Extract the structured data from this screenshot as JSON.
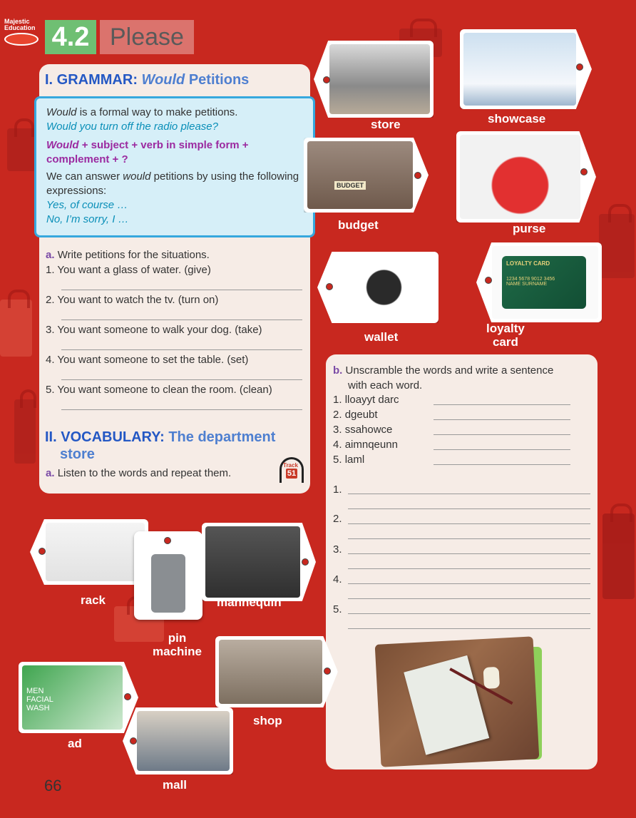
{
  "logo": {
    "line1": "Majestic",
    "line2": "Education"
  },
  "unit": {
    "number": "4.2",
    "title": "Please"
  },
  "grammar": {
    "heading_prefix": "I. GRAMMAR:",
    "heading_italic": "Would",
    "heading_rest": "Petitions",
    "box": {
      "p1_italic": "Would",
      "p1_rest": "is a formal way to make petitions.",
      "p2": "Would you turn off the radio please?",
      "p3_italic": "Would",
      "p3_rest": "+ subject + verb in simple form + complement + ?",
      "p4_a": "We can answer",
      "p4_italic": "would",
      "p4_b": "petitions by using the following expressions:",
      "p5": "Yes, of course …",
      "p6": "No, I’m sorry, I …"
    },
    "exercise_a": {
      "label": "a.",
      "instruction": "Write petitions for the situations.",
      "items": [
        {
          "num": "1.",
          "text": "You want a glass of water. (give)"
        },
        {
          "num": "2.",
          "text": "You want to watch the tv. (turn on)"
        },
        {
          "num": "3.",
          "text": "You want someone to walk your dog. (take)"
        },
        {
          "num": "4.",
          "text": "You want someone to set the table. (set)"
        },
        {
          "num": "5.",
          "text": "You want someone to clean the room. (clean)"
        }
      ]
    }
  },
  "vocabulary": {
    "heading_prefix": "II. VOCABULARY:",
    "heading_rest_1": "The department",
    "heading_rest_2": "store",
    "exercise_a": {
      "label": "a.",
      "instruction": "Listen to the words and repeat them."
    },
    "track": {
      "label": "Track",
      "number": "51"
    }
  },
  "unscramble": {
    "label": "b.",
    "instruction_1": "Unscramble the words and write a sentence",
    "instruction_2": "with each word.",
    "words": [
      {
        "num": "1.",
        "text": "lloayyt darc"
      },
      {
        "num": "2.",
        "text": "dgeubt"
      },
      {
        "num": "3.",
        "text": "ssahowce"
      },
      {
        "num": "4.",
        "text": "aimnqeunn"
      },
      {
        "num": "5.",
        "text": "laml"
      }
    ],
    "sentence_numbers": [
      "1.",
      "2.",
      "3.",
      "4.",
      "5."
    ]
  },
  "tags": {
    "store": "store",
    "showcase": "showcase",
    "budget": "budget",
    "purse": "purse",
    "wallet": "wallet",
    "loyalty_1": "loyalty",
    "loyalty_2": "card",
    "rack": "rack",
    "mannequin": "mannequin",
    "pin_1": "pin",
    "pin_2": "machine",
    "shop": "shop",
    "ad": "ad",
    "mall": "mall"
  },
  "photo_text": {
    "budget_jar": "BUDGET",
    "loyalty_title": "LOYALTY CARD",
    "loyalty_number": "1234 5678 9012 3456",
    "loyalty_name": "NAME SURNAME",
    "ad_text": "MEN FACIAL WASH"
  },
  "page_number": "66",
  "colors": {
    "background": "#c8281f",
    "panel": "#f6ece6",
    "grammar_box": "#d6eff8",
    "accent_blue": "#2458c4",
    "accent_green": "#6fbf73"
  }
}
